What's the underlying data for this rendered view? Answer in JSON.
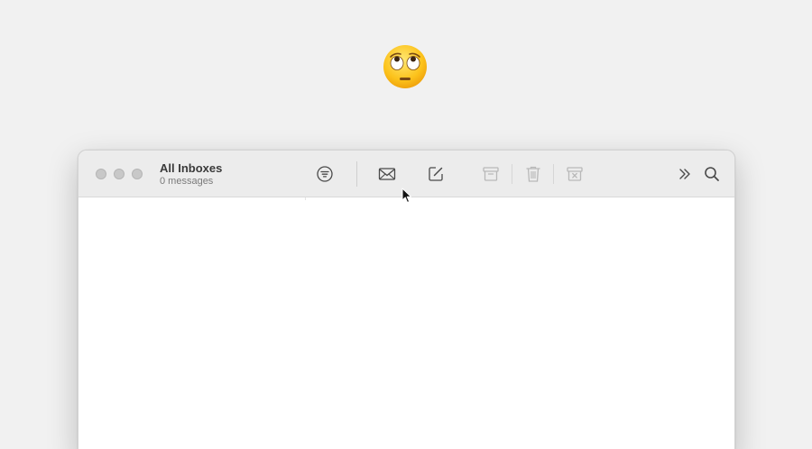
{
  "mailbox": {
    "title": "All Inboxes",
    "count_label": "0 messages"
  },
  "toolbar": {
    "buttons": [
      {
        "name": "filter-icon",
        "enabled": true
      },
      {
        "name": "get-mail-icon",
        "enabled": true
      },
      {
        "name": "compose-icon",
        "enabled": true
      },
      {
        "name": "archive-icon",
        "enabled": false
      },
      {
        "name": "trash-icon",
        "enabled": false
      },
      {
        "name": "junk-icon",
        "enabled": false
      },
      {
        "name": "more-chevron-icon",
        "enabled": true
      },
      {
        "name": "search-icon",
        "enabled": true
      }
    ]
  },
  "colors": {
    "desktop": "#f1f1f1",
    "toolbar": "#ececec",
    "icon_enabled": "#4a4a4a",
    "icon_disabled": "#b8b8b8"
  },
  "decor": {
    "emoji": "face-with-rolling-eyes"
  }
}
